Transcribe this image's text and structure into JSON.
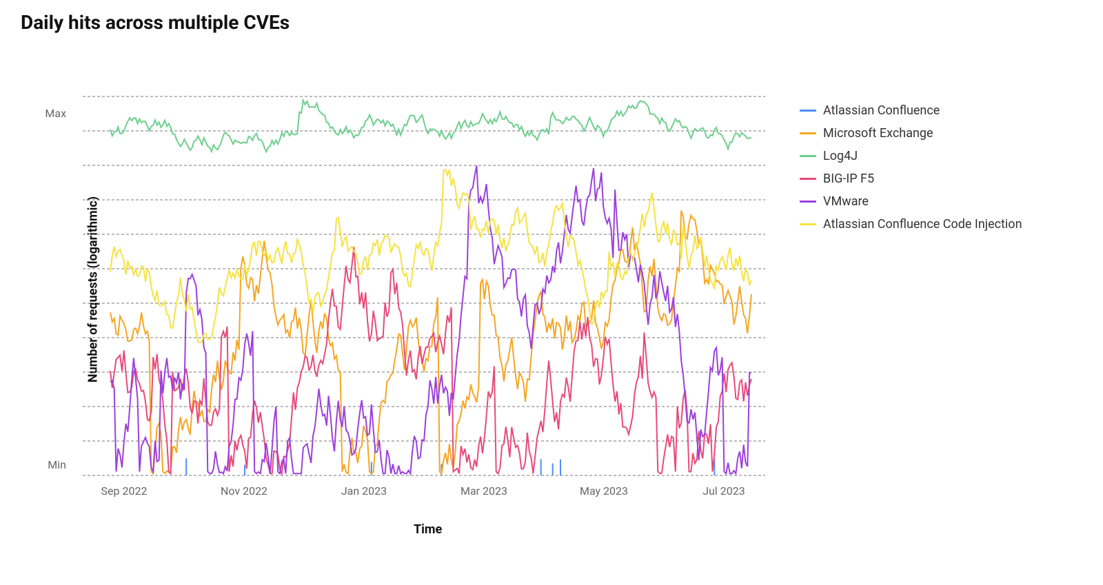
{
  "chart_data": {
    "type": "line",
    "title": "Daily hits across multiple CVEs",
    "xlabel": "Time",
    "ylabel": "Number of requests (logarithmic)",
    "ylim": [
      0,
      100
    ],
    "y_scale": "logarithmic_normalized",
    "y_ticks": [
      "Min",
      "Max"
    ],
    "x_ticks": [
      "Sep 2022",
      "Nov 2022",
      "Jan 2023",
      "Mar 2023",
      "May 2023",
      "Jul 2023"
    ],
    "x_domain": [
      "Aug 2022",
      "Aug 2023"
    ],
    "n_points": 330,
    "colors": {
      "Atlassian Confluence": "#4f8ef7",
      "Microsoft Exchange": "#f5a623",
      "Log4J": "#6ecf8f",
      "BIG-IP F5": "#e84a7a",
      "VMware": "#9c3fdc",
      "Atlassian Confluence Code Injection": "#f5e342"
    },
    "series": [
      {
        "name": "Atlassian Confluence",
        "baseline": 1,
        "noise": 0,
        "sparse_spikes": true
      },
      {
        "name": "Microsoft Exchange",
        "baseline": 38,
        "noise": 14
      },
      {
        "name": "Log4J",
        "baseline": 90,
        "noise": 4
      },
      {
        "name": "BIG-IP F5",
        "baseline": 27,
        "noise": 16
      },
      {
        "name": "VMware",
        "baseline": 26,
        "noise": 17
      },
      {
        "name": "Atlassian Confluence Code Injection",
        "baseline": 55,
        "noise": 10
      }
    ],
    "legend": [
      "Atlassian Confluence",
      "Microsoft Exchange",
      "Log4J",
      "BIG-IP F5",
      "VMware",
      "Atlassian Confluence Code Injection"
    ]
  }
}
